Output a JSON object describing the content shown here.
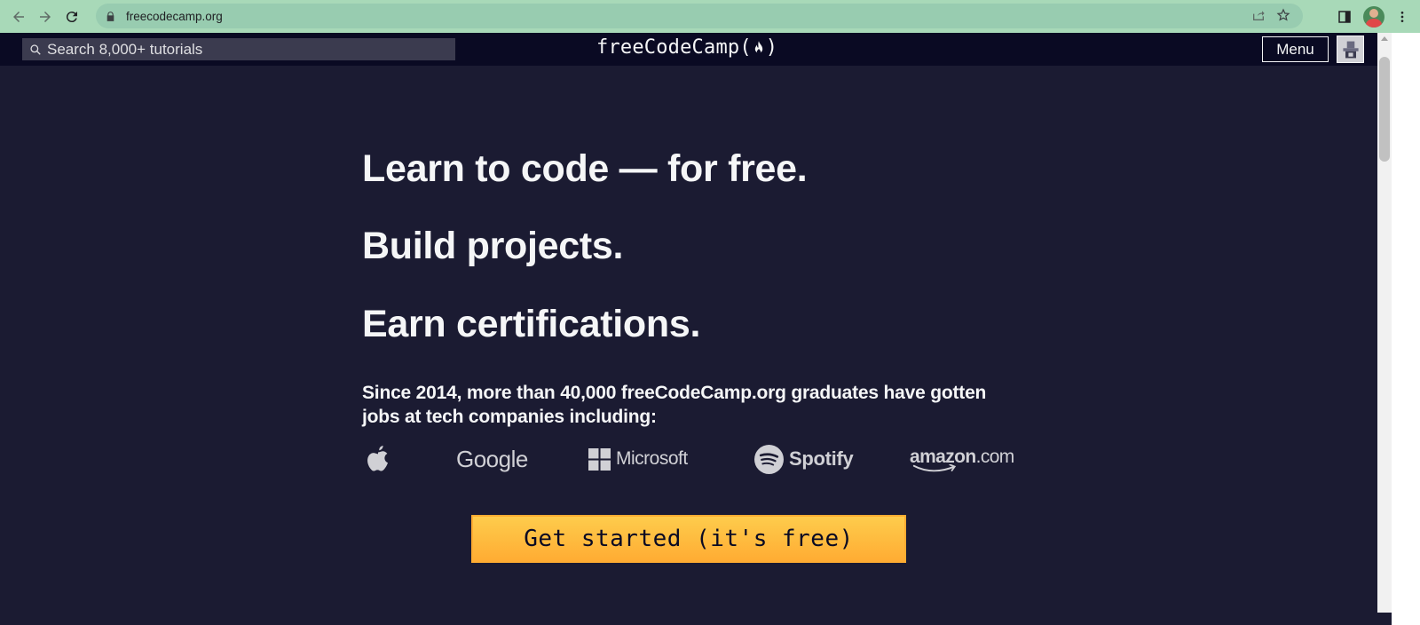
{
  "browser": {
    "url": "freecodecamp.org"
  },
  "nav": {
    "search_placeholder": "Search 8,000+ tutorials",
    "logo_text_left": "freeCodeCamp(",
    "logo_text_right": ")",
    "menu_label": "Menu"
  },
  "hero": {
    "line1": "Learn to code — for free.",
    "line2": "Build projects.",
    "line3": "Earn certifications.",
    "since": "Since 2014, more than 40,000 freeCodeCamp.org graduates have gotten jobs at tech companies including:",
    "cta_label": "Get started (it's free)"
  },
  "companies": {
    "google": "Google",
    "microsoft": "Microsoft",
    "spotify": "Spotify",
    "amazon_main": "amazon",
    "amazon_suffix": ".com"
  },
  "colors": {
    "page_bg": "#1b1b32",
    "nav_bg": "#0a0a23",
    "text": "#f5f6f7",
    "cta_top": "#fecc4c",
    "cta_bottom": "#ffac33",
    "browser_bar": "#a8d9b8"
  },
  "icons": {
    "back": "arrow-left-icon",
    "forward": "arrow-right-icon",
    "reload": "reload-icon",
    "lock": "lock-icon",
    "share": "share-icon",
    "bookmark": "star-icon",
    "sidepanel": "side-panel-icon",
    "more": "kebab-menu-icon",
    "search": "magnifier-icon",
    "flame": "flame-icon",
    "apple": "apple-logo",
    "microsoft": "windows-logo",
    "spotify": "spotify-logo"
  }
}
